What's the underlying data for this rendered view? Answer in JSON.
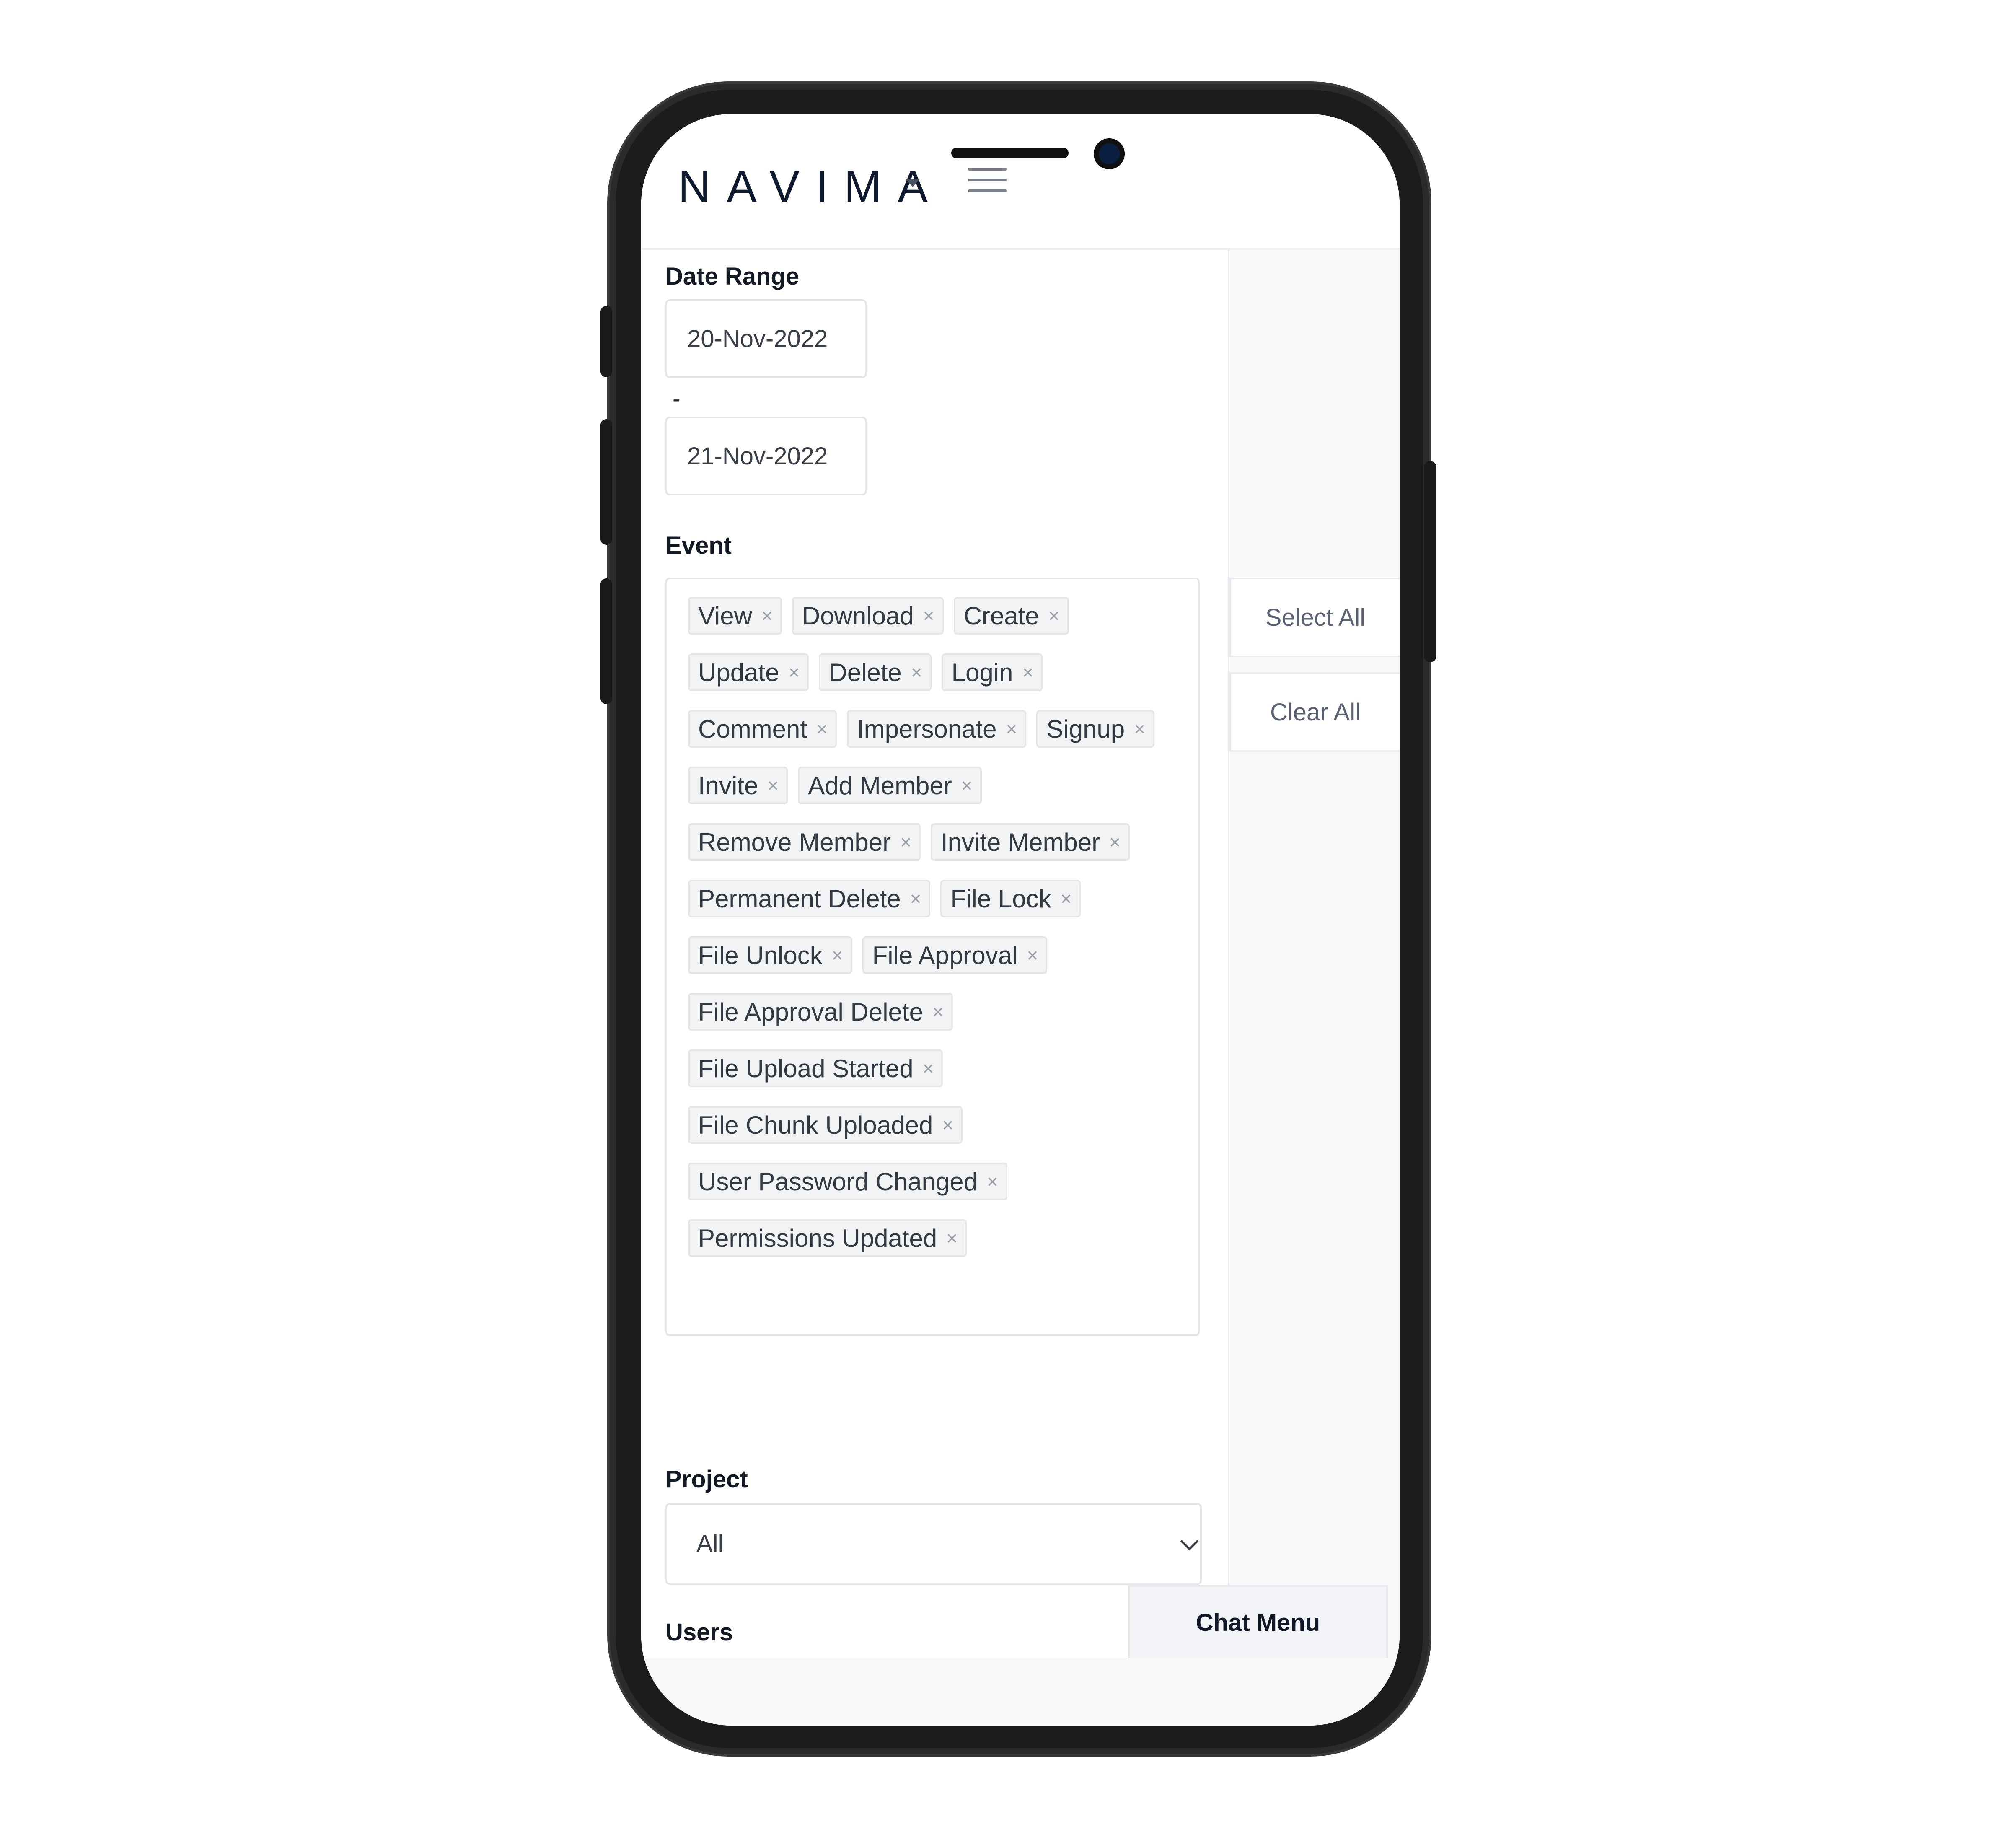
{
  "header": {
    "logo_text": "NAVIMA"
  },
  "filters": {
    "date_range": {
      "label": "Date Range",
      "start": "20-Nov-2022",
      "separator": "-",
      "end": "21-Nov-2022"
    },
    "event": {
      "label": "Event",
      "tags": [
        [
          "View",
          "Download",
          "Create"
        ],
        [
          "Update",
          "Delete",
          "Login"
        ],
        [
          "Comment",
          "Impersonate",
          "Signup"
        ],
        [
          "Invite",
          "Add Member"
        ],
        [
          "Remove Member",
          "Invite Member"
        ],
        [
          "Permanent Delete",
          "File Lock"
        ],
        [
          "File Unlock",
          "File Approval"
        ],
        [
          "File Approval Delete"
        ],
        [
          "File Upload Started"
        ],
        [
          "File Chunk Uploaded"
        ],
        [
          "User Password Changed"
        ],
        [
          "Permissions Updated"
        ]
      ],
      "remove_glyph": "×",
      "select_all_label": "Select All",
      "clear_all_label": "Clear All"
    },
    "project": {
      "label": "Project",
      "selected": "All"
    },
    "users": {
      "label": "Users"
    }
  },
  "chat_menu": {
    "label": "Chat Menu"
  },
  "icons": {
    "menu": "hamburger-menu-icon",
    "dropdown": "caret-down-icon",
    "select": "chevron-down-icon",
    "tag_remove": "close-icon"
  }
}
